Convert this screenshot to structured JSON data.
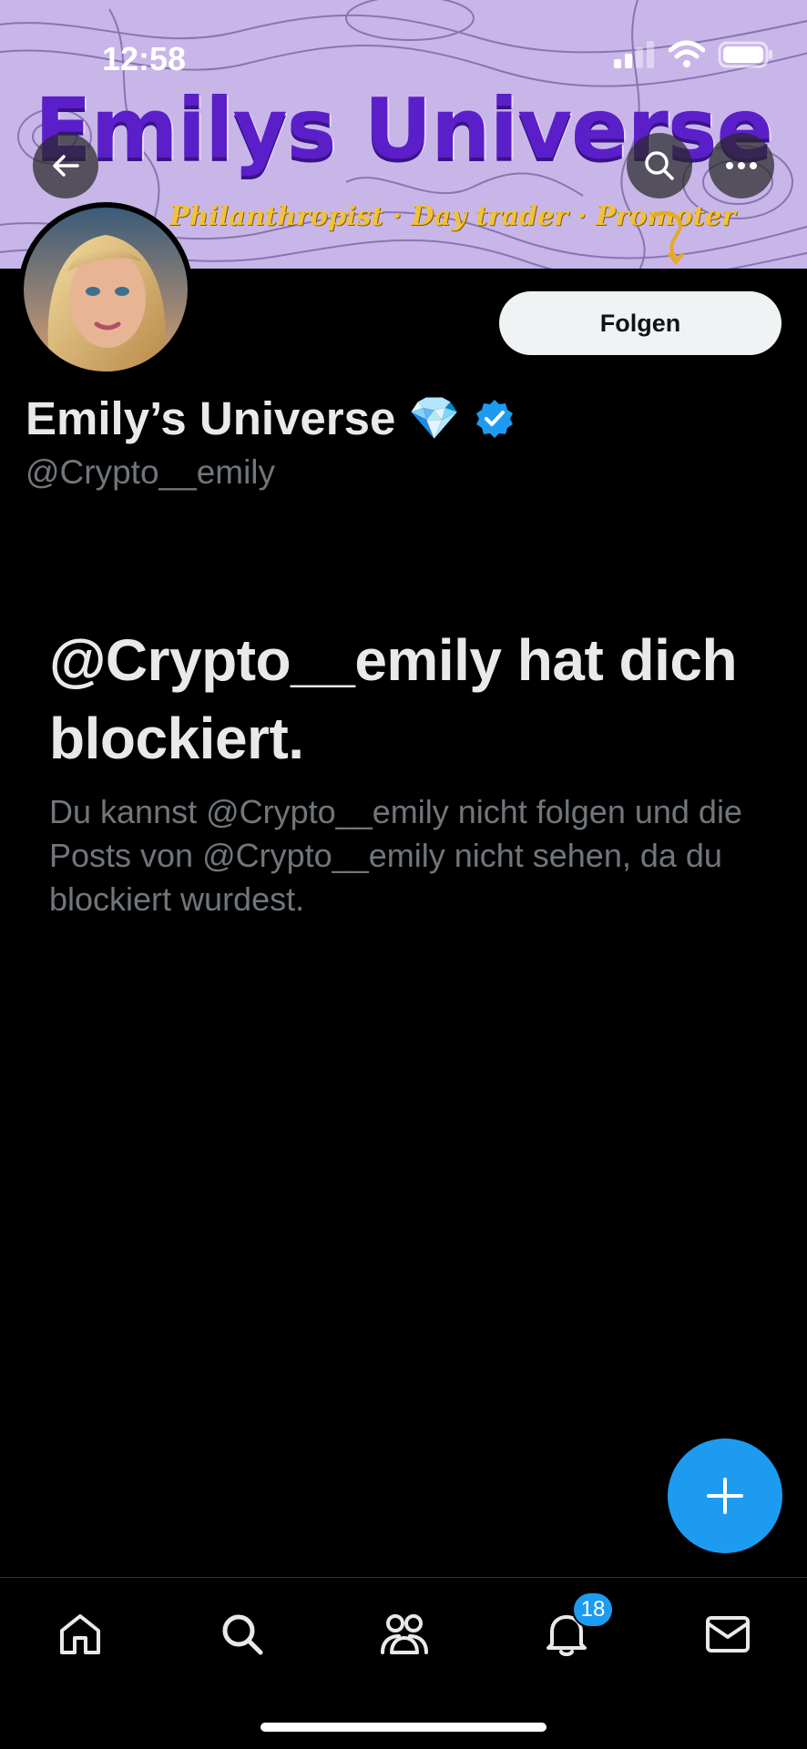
{
  "status_bar": {
    "time": "12:58"
  },
  "banner": {
    "title": "Emilys Universe",
    "subtitle": "Philanthropist · Day trader · Promoter"
  },
  "header_buttons": {
    "back": "back-arrow-icon",
    "search": "search-icon",
    "more": "more-icon"
  },
  "profile": {
    "display_name": "Emily’s Universe",
    "emoji": "💎",
    "handle": "@Crypto__emily",
    "follow_label": "Folgen"
  },
  "blocked": {
    "title": "@Crypto__emily hat dich blockiert.",
    "message": "Du kannst @Crypto__emily nicht folgen und die Posts von @Crypto__emily nicht sehen, da du blockiert wurdest."
  },
  "bottom_nav": {
    "items": [
      "home-icon",
      "search-icon",
      "communities-icon",
      "notifications-icon",
      "messages-icon"
    ],
    "notification_count": "18"
  },
  "colors": {
    "accent": "#1d9bf0",
    "background": "#000000",
    "banner_text": "#5a1fc9",
    "subtitle": "#f0c23a"
  }
}
